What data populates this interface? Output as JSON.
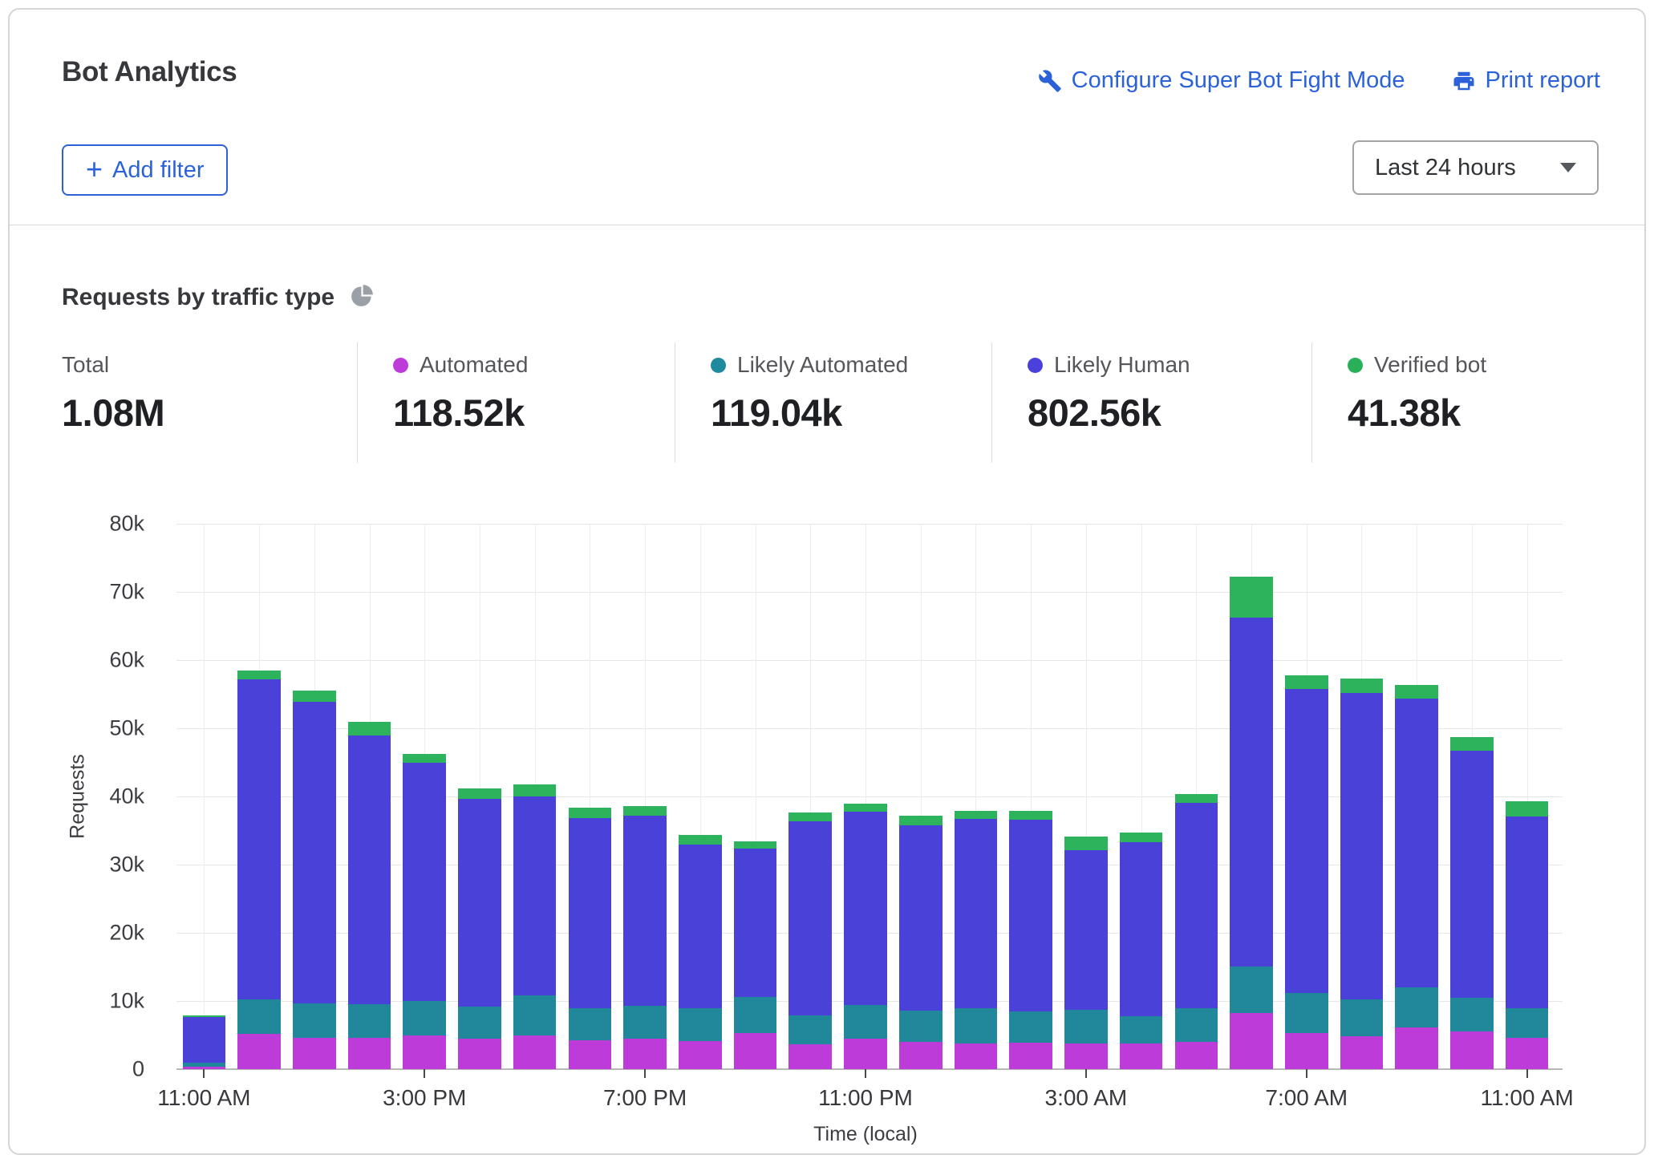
{
  "header": {
    "title": "Bot Analytics",
    "configure_link_label": "Configure Super Bot Fight Mode",
    "print_link_label": "Print report",
    "add_filter_label": "Add filter",
    "plus_glyph": "+",
    "time_range_value": "Last 24 hours"
  },
  "section": {
    "title": "Requests by traffic type"
  },
  "stats": [
    {
      "label": "Total",
      "value": "1.08M",
      "color": null
    },
    {
      "label": "Automated",
      "value": "118.52k",
      "color": "#bd3bd8"
    },
    {
      "label": "Likely Automated",
      "value": "119.04k",
      "color": "#1f8a9e"
    },
    {
      "label": "Likely Human",
      "value": "802.56k",
      "color": "#4a40dc"
    },
    {
      "label": "Verified bot",
      "value": "41.38k",
      "color": "#2ab059"
    }
  ],
  "chart_data": {
    "type": "bar",
    "stacked": true,
    "title": "Requests by traffic type",
    "xlabel": "Time (local)",
    "ylabel": "Requests",
    "ylim": [
      0,
      80000
    ],
    "grid": true,
    "bar_count": 25,
    "y_tick_labels": [
      "0",
      "10k",
      "20k",
      "30k",
      "40k",
      "50k",
      "60k",
      "70k",
      "80k"
    ],
    "x_tick_labels": [
      "11:00 AM",
      "3:00 PM",
      "7:00 PM",
      "11:00 PM",
      "3:00 AM",
      "7:00 AM",
      "11:00 AM"
    ],
    "x_tick_bar_indices": [
      0,
      4,
      8,
      12,
      16,
      20,
      24
    ],
    "series": [
      {
        "name": "Automated",
        "color": "#bd3bd8",
        "values": [
          400,
          5200,
          4600,
          4600,
          4900,
          4500,
          4900,
          4200,
          4500,
          4100,
          5300,
          3600,
          4500,
          4000,
          3800,
          3900,
          3800,
          3800,
          4000,
          8200,
          5300,
          4800,
          6100,
          5500,
          4600
        ]
      },
      {
        "name": "Likely Automated",
        "color": "#21879b",
        "values": [
          600,
          5000,
          5100,
          4900,
          5100,
          4700,
          5900,
          4700,
          4800,
          4900,
          5300,
          4300,
          4900,
          4600,
          5100,
          4600,
          4900,
          4000,
          5000,
          6900,
          5900,
          5400,
          5900,
          5000,
          4300
        ]
      },
      {
        "name": "Likely Human",
        "color": "#4a42d8",
        "values": [
          6600,
          47000,
          44200,
          39500,
          34900,
          30400,
          29200,
          27900,
          27900,
          24000,
          21800,
          28500,
          28400,
          27200,
          27800,
          28100,
          23400,
          25500,
          30100,
          51100,
          44600,
          45000,
          42400,
          36200,
          28200
        ]
      },
      {
        "name": "Verified bot",
        "color": "#2db35c",
        "values": [
          300,
          1300,
          1600,
          1900,
          1300,
          1600,
          1800,
          1600,
          1400,
          1300,
          1000,
          1200,
          1100,
          1400,
          1200,
          1300,
          2000,
          1400,
          1300,
          6000,
          2000,
          2100,
          2000,
          2000,
          2200
        ]
      }
    ],
    "series_totals": {
      "Total": "1.08M",
      "Automated": "118.52k",
      "Likely Automated": "119.04k",
      "Likely Human": "802.56k",
      "Verified bot": "41.38k"
    }
  }
}
